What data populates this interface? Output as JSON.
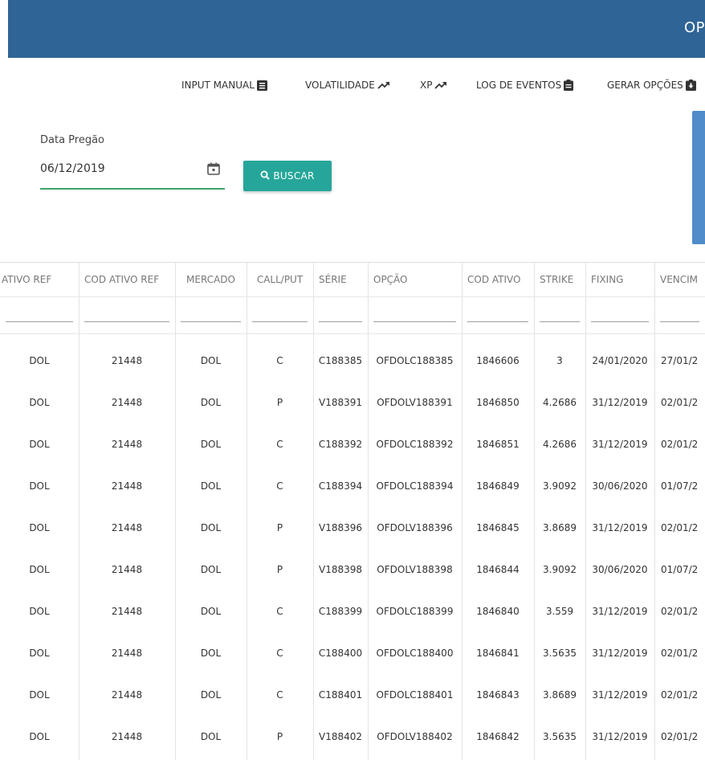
{
  "header": {
    "title": "OP"
  },
  "nav": [
    {
      "label": "INPUT MANUAL",
      "icon": "list-icon"
    },
    {
      "label": "VOLATILIDADE",
      "icon": "trending-up-icon"
    },
    {
      "label": "XP",
      "icon": "trending-up-icon"
    },
    {
      "label": "LOG DE EVENTOS",
      "icon": "clipboard-icon"
    },
    {
      "label": "GERAR OPÇÕES",
      "icon": "download-icon"
    }
  ],
  "date_filter": {
    "label": "Data Pregão",
    "value": "06/12/2019"
  },
  "search_button": {
    "label": "BUSCAR"
  },
  "table": {
    "columns": [
      "ATIVO REF",
      "COD ATIVO REF",
      "MERCADO",
      "CALL/PUT",
      "SÉRIE",
      "OPÇÃO",
      "COD ATIVO",
      "STRIKE",
      "FIXING",
      "VENCIM"
    ],
    "rows": [
      [
        "DOL",
        "21448",
        "DOL",
        "C",
        "C188385",
        "OFDOLC188385",
        "1846606",
        "3",
        "24/01/2020",
        "27/01/2"
      ],
      [
        "DOL",
        "21448",
        "DOL",
        "P",
        "V188391",
        "OFDOLV188391",
        "1846850",
        "4.2686",
        "31/12/2019",
        "02/01/2"
      ],
      [
        "DOL",
        "21448",
        "DOL",
        "C",
        "C188392",
        "OFDOLC188392",
        "1846851",
        "4.2686",
        "31/12/2019",
        "02/01/2"
      ],
      [
        "DOL",
        "21448",
        "DOL",
        "C",
        "C188394",
        "OFDOLC188394",
        "1846849",
        "3.9092",
        "30/06/2020",
        "01/07/2"
      ],
      [
        "DOL",
        "21448",
        "DOL",
        "P",
        "V188396",
        "OFDOLV188396",
        "1846845",
        "3.8689",
        "31/12/2019",
        "02/01/2"
      ],
      [
        "DOL",
        "21448",
        "DOL",
        "P",
        "V188398",
        "OFDOLV188398",
        "1846844",
        "3.9092",
        "30/06/2020",
        "01/07/2"
      ],
      [
        "DOL",
        "21448",
        "DOL",
        "C",
        "C188399",
        "OFDOLC188399",
        "1846840",
        "3.559",
        "31/12/2019",
        "02/01/2"
      ],
      [
        "DOL",
        "21448",
        "DOL",
        "C",
        "C188400",
        "OFDOLC188400",
        "1846841",
        "3.5635",
        "31/12/2019",
        "02/01/2"
      ],
      [
        "DOL",
        "21448",
        "DOL",
        "C",
        "C188401",
        "OFDOLC188401",
        "1846843",
        "3.8689",
        "31/12/2019",
        "02/01/2"
      ],
      [
        "DOL",
        "21448",
        "DOL",
        "P",
        "V188402",
        "OFDOLV188402",
        "1846842",
        "3.5635",
        "31/12/2019",
        "02/01/2"
      ]
    ]
  },
  "colors": {
    "header_bg": "#2f6497",
    "button_bg": "#26a69a",
    "input_underline": "#3aa56b"
  }
}
